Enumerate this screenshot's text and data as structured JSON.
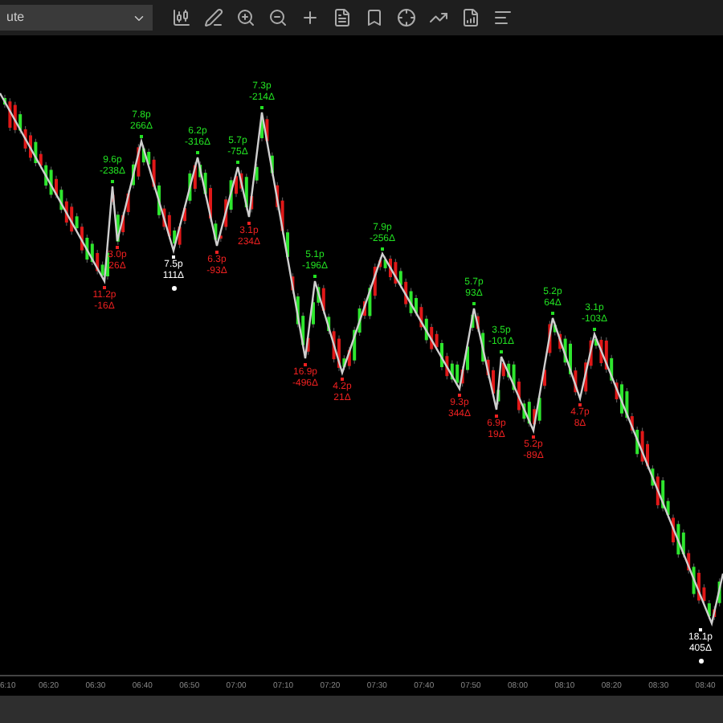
{
  "toolbar": {
    "dropdown_value": "ute"
  },
  "pivots": [
    {
      "kind": "low",
      "price": "11.2p",
      "delta": "-16Δ",
      "highlighted": false
    },
    {
      "kind": "high",
      "price": "9.6p",
      "delta": "-238Δ",
      "highlighted": false
    },
    {
      "kind": "low",
      "price": "3.0p",
      "delta": "26Δ",
      "highlighted": false
    },
    {
      "kind": "high",
      "price": "7.8p",
      "delta": "266Δ",
      "highlighted": false
    },
    {
      "kind": "low",
      "price": "7.5p",
      "delta": "111Δ",
      "highlighted": true
    },
    {
      "kind": "high",
      "price": "6.2p",
      "delta": "-316Δ",
      "highlighted": false
    },
    {
      "kind": "low",
      "price": "6.3p",
      "delta": "-93Δ",
      "highlighted": false
    },
    {
      "kind": "high",
      "price": "5.7p",
      "delta": "-75Δ",
      "highlighted": false
    },
    {
      "kind": "low",
      "price": "3.1p",
      "delta": "234Δ",
      "highlighted": false
    },
    {
      "kind": "high",
      "price": "7.3p",
      "delta": "-214Δ",
      "highlighted": false
    },
    {
      "kind": "low",
      "price": "16.9p",
      "delta": "-496Δ",
      "highlighted": false
    },
    {
      "kind": "high",
      "price": "5.1p",
      "delta": "-196Δ",
      "highlighted": false
    },
    {
      "kind": "low",
      "price": "4.2p",
      "delta": "21Δ",
      "highlighted": false
    },
    {
      "kind": "high",
      "price": "7.9p",
      "delta": "-256Δ",
      "highlighted": false
    },
    {
      "kind": "low",
      "price": "9.3p",
      "delta": "344Δ",
      "highlighted": false
    },
    {
      "kind": "high",
      "price": "5.7p",
      "delta": "93Δ",
      "highlighted": false
    },
    {
      "kind": "low",
      "price": "6.9p",
      "delta": "19Δ",
      "highlighted": false
    },
    {
      "kind": "high",
      "price": "3.5p",
      "delta": "-101Δ",
      "highlighted": false
    },
    {
      "kind": "low",
      "price": "5.2p",
      "delta": "-89Δ",
      "highlighted": false
    },
    {
      "kind": "high",
      "price": "5.2p",
      "delta": "64Δ",
      "highlighted": false
    },
    {
      "kind": "low",
      "price": "4.7p",
      "delta": "8Δ",
      "highlighted": false
    },
    {
      "kind": "high",
      "price": "3.1p",
      "delta": "-103Δ",
      "highlighted": false
    },
    {
      "kind": "low",
      "price": "18.1p",
      "delta": "405Δ",
      "highlighted": true
    }
  ],
  "time_axis": [
    "6:10",
    "06:20",
    "06:30",
    "06:40",
    "06:50",
    "07:00",
    "07:10",
    "07:20",
    "07:30",
    "07:40",
    "07:50",
    "08:00",
    "08:10",
    "08:20",
    "08:30",
    "08:40"
  ]
}
